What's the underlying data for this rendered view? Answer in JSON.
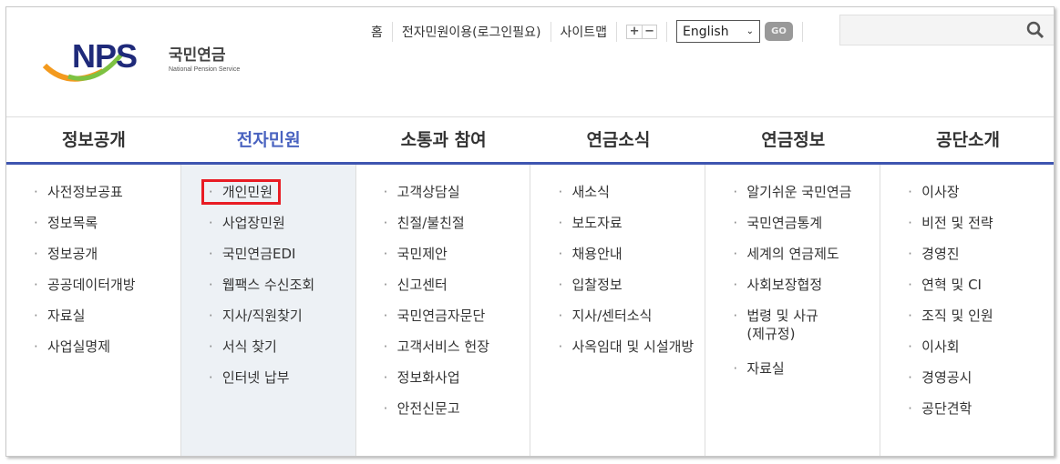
{
  "logo": {
    "mark": "NPS",
    "name_ko": "국민연금",
    "name_en": "National Pension Service"
  },
  "util": {
    "home": "홈",
    "eservice": "전자민원이용(로그인필요)",
    "sitemap": "사이트맵",
    "zoom_in": "+",
    "zoom_out": "−",
    "language": "English",
    "go": "GO"
  },
  "search": {
    "value": "",
    "icon": "search-icon"
  },
  "nav": [
    {
      "label": "정보공개"
    },
    {
      "label": "전자민원"
    },
    {
      "label": "소통과 참여"
    },
    {
      "label": "연금소식"
    },
    {
      "label": "연금정보"
    },
    {
      "label": "공단소개"
    }
  ],
  "active_nav": "전자민원",
  "active_color": "#4a63c0",
  "highlight_color": "#e81c24",
  "columns": [
    [
      "사전정보공표",
      "정보목록",
      "정보공개",
      "공공데이터개방",
      "자료실",
      "사업실명제"
    ],
    [
      "개인민원",
      "사업장민원",
      "국민연금EDI",
      "웹팩스 수신조회",
      "지사/직원찾기",
      "서식 찾기",
      "인터넷 납부"
    ],
    [
      "고객상담실",
      "친절/불친절",
      "국민제안",
      "신고센터",
      "국민연금자문단",
      "고객서비스 헌장",
      "정보화사업",
      "안전신문고"
    ],
    [
      "새소식",
      "보도자료",
      "채용안내",
      "입찰정보",
      "지사/센터소식",
      "사옥임대 및 시설개방"
    ],
    [
      "알기쉬운 국민연금",
      "국민연금통계",
      "세계의 연금제도",
      "사회보장협정",
      "법령 및 사규(제규정)",
      "자료실"
    ],
    [
      "이사장",
      "비전 및 전략",
      "경영진",
      "연혁 및 CI",
      "조직 및 인원",
      "이사회",
      "경영공시",
      "공단견학"
    ]
  ]
}
